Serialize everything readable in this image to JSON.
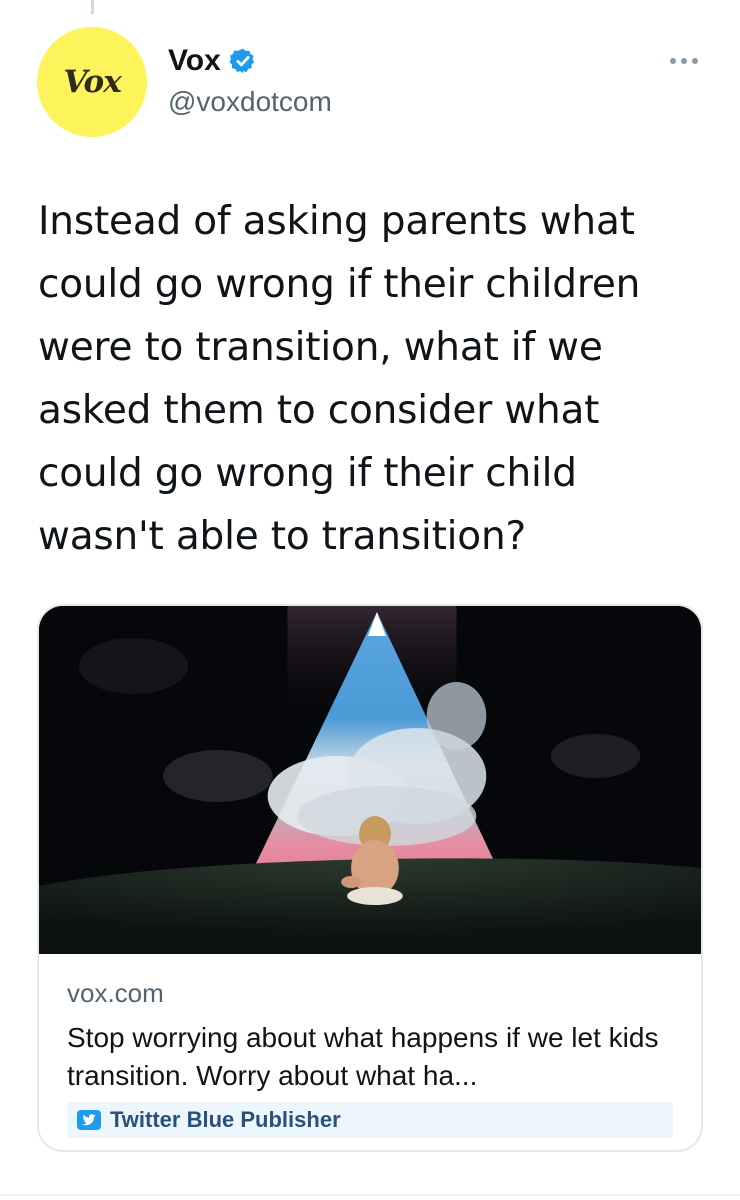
{
  "account": {
    "avatar_text": "Vox",
    "display_name": "Vox",
    "handle": "@voxdotcom",
    "verified": true
  },
  "tweet": {
    "text": "Instead of asking parents what could go wrong if their children were to transition, what if we asked them to consider what could go wrong if their child wasn't able to transition?"
  },
  "link_card": {
    "domain": "vox.com",
    "title": "Stop worrying about what happens if we let kids transition. Worry about what ha...",
    "publisher_label": "Twitter Blue Publisher"
  },
  "icons": {
    "verified": "verified-badge-icon",
    "more": "more-options-icon",
    "publisher": "twitter-bird-icon"
  },
  "colors": {
    "avatar_background": "#fdf45c",
    "verified_blue": "#1d9bf0",
    "secondary_text": "#536471",
    "badge_background": "#eef6fd"
  }
}
